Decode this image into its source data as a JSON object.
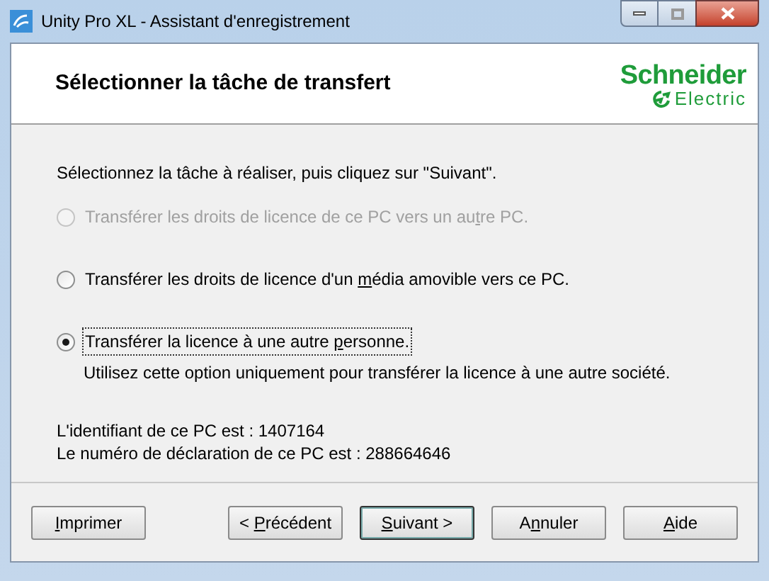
{
  "window": {
    "title": "Unity Pro XL - Assistant d'enregistrement"
  },
  "header": {
    "title": "Sélectionner la tâche de transfert",
    "logo": {
      "line_1": "Schneider",
      "line_2": "Electric"
    }
  },
  "instruction": "Sélectionnez la tâche à réaliser, puis cliquez sur \"Suivant\".",
  "options": [
    {
      "before": "Transférer les droits de licence de ce PC vers un au",
      "mnemonic": "t",
      "after": "re PC.",
      "selected": false,
      "disabled": true,
      "focused": false
    },
    {
      "before": "Transférer les droits de licence d'un ",
      "mnemonic": "m",
      "after": "édia amovible vers ce PC.",
      "selected": false,
      "disabled": false,
      "focused": false
    },
    {
      "before": "Transférer la licence à une autre ",
      "mnemonic": "p",
      "after": "ersonne.",
      "selected": true,
      "disabled": false,
      "focused": true,
      "description": "Utilisez cette option uniquement pour transférer la licence à une autre société."
    }
  ],
  "info": [
    "L'identifiant de ce PC est : 1407164",
    "Le numéro de déclaration de ce PC est : 288664646"
  ],
  "buttons": [
    {
      "mnemonic": "I",
      "after": "mprimer",
      "default": false
    },
    {
      "before": "< ",
      "mnemonic": "P",
      "after": "récédent",
      "default": false
    },
    {
      "mnemonic": "S",
      "after": "uivant >",
      "default": true
    },
    {
      "before": "A",
      "mnemonic": "n",
      "after": "nuler",
      "default": false
    },
    {
      "mnemonic": "A",
      "after": "ide",
      "default": false
    }
  ]
}
